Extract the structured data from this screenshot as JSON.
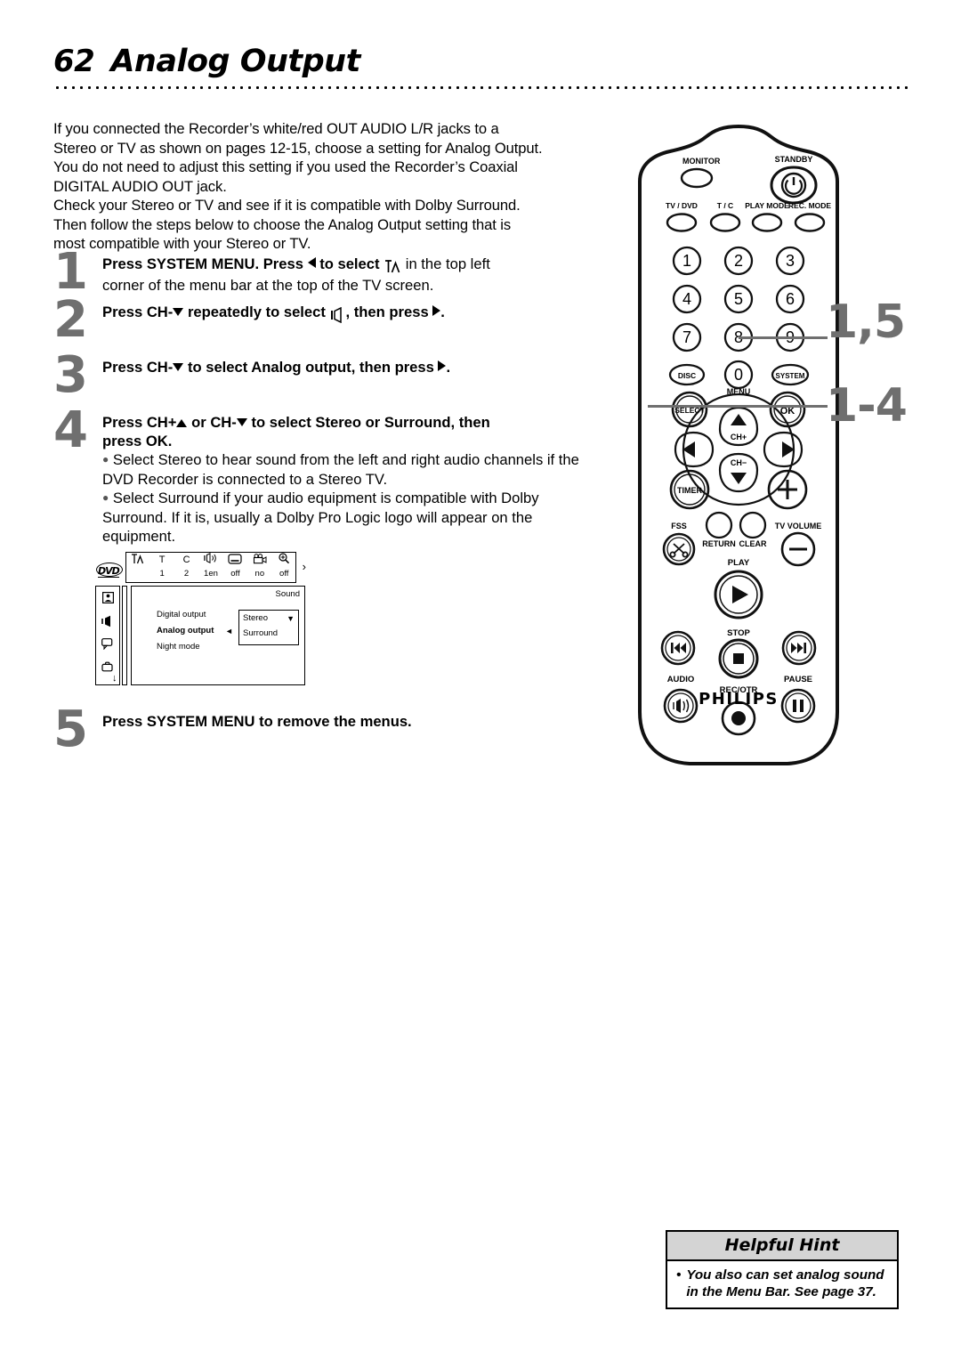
{
  "header": {
    "page_number": "62",
    "title": "Analog Output"
  },
  "intro": {
    "lines": [
      "If you connected the Recorder’s white/red OUT AUDIO L/R jacks to a",
      "Stereo or TV as shown on pages 12-15, choose a setting for Analog Output.",
      "You do not need to adjust this setting if you used the Recorder’s Coaxial",
      "DIGITAL AUDIO OUT jack.",
      "Check your Stereo or TV and see if it is compatible with Dolby Surround.",
      "Then follow the steps below to choose the Analog Output setting that is",
      "most compatible with your Stereo or TV."
    ]
  },
  "steps": [
    {
      "number": "1",
      "lead_a": "Press SYSTEM MENU. Press",
      "lead_b": "to select",
      "lead_c": "in the top left",
      "sub": "corner of the menu bar at the top of the TV screen."
    },
    {
      "number": "2",
      "lead_a": "Press CH-",
      "lead_b": "repeatedly to select",
      "lead_c": ", then press"
    },
    {
      "number": "3",
      "lead_a": "Press CH-",
      "lead_b": "to select Analog output, then press"
    },
    {
      "number": "4",
      "lead_a": "Press CH+",
      "lead_b": "or CH-",
      "lead_c": "to select Stereo or Surround, then",
      "lead_d": "press OK.",
      "bullets": [
        "Select Stereo to hear sound from the left and right audio channels if the DVD Recorder is connected to a Stereo TV.",
        "Select Surround if your audio equipment is compatible with Dolby Surround. If it is, usually a Dolby Pro Logic logo will appear on the equipment."
      ]
    },
    {
      "number": "5",
      "lead_a": "Press SYSTEM MENU",
      "lead_b": "to remove the menus."
    }
  ],
  "tv_menu": {
    "disc_logo": "DVD",
    "menu_bar": [
      {
        "icon": "tuner-antenna-icon",
        "glyph": "Tʎ",
        "value": ""
      },
      {
        "icon": "title-icon",
        "glyph": "T",
        "value": "1"
      },
      {
        "icon": "chapter-icon",
        "glyph": "C",
        "value": "2"
      },
      {
        "icon": "audio-language-icon",
        "glyph": "бƒ",
        "value": "1en"
      },
      {
        "icon": "subtitle-icon",
        "glyph": "subtitle",
        "value": "off"
      },
      {
        "icon": "camera-angle-icon",
        "glyph": "camera",
        "value": "no"
      },
      {
        "icon": "zoom-icon",
        "glyph": "zoom",
        "value": "off"
      }
    ],
    "bar_arrow": "›",
    "sidebar_icons": [
      "picture-icon",
      "sound-icon",
      "language-icon",
      "features-icon"
    ],
    "sidebar_arrow": "↓",
    "panel_title": "Sound",
    "rows": [
      {
        "label": "Digital output",
        "selected": false
      },
      {
        "label": "Analog output",
        "selected": true
      },
      {
        "label": "Night mode",
        "selected": false
      }
    ],
    "left_arrow": "◄",
    "options": [
      "Stereo",
      "Surround"
    ],
    "option_arrow": "▼"
  },
  "remote": {
    "brand": "PHILIPS",
    "labels": {
      "standby": "STANDBY",
      "monitor": "MONITOR",
      "tv_dvd": "TV / DVD",
      "t_c": "T / C",
      "play_mode": "PLAY MODE",
      "rec_mode": "REC. MODE",
      "disc": "DISC",
      "menu": "MENU",
      "system": "SYSTEM",
      "select": "SELECT",
      "ok": "OK",
      "ch_plus": "CH+",
      "ch_minus": "CH−",
      "timer": "TIMER",
      "tv_volume": "TV VOLUME",
      "fss": "FSS",
      "return": "RETURN",
      "clear": "CLEAR",
      "play": "PLAY",
      "stop": "STOP",
      "audio": "AUDIO",
      "rec_otr": "REC/OTR",
      "pause": "PAUSE"
    },
    "numbers": [
      "1",
      "2",
      "3",
      "4",
      "5",
      "6",
      "7",
      "8",
      "9",
      "0"
    ]
  },
  "callouts": [
    {
      "name": "callout-system-menu",
      "text": "1,5"
    },
    {
      "name": "callout-navigation",
      "text": "1-4"
    }
  ],
  "hint": {
    "title": "Helpful Hint",
    "bullet": "•",
    "text": "You also can set analog sound in the Menu Bar. See page 37."
  },
  "colors": {
    "step_number": "#6f6f6f",
    "callout": "#6f6f6f",
    "hint_header_bg": "#d4d4d4",
    "ink": "#000000"
  }
}
